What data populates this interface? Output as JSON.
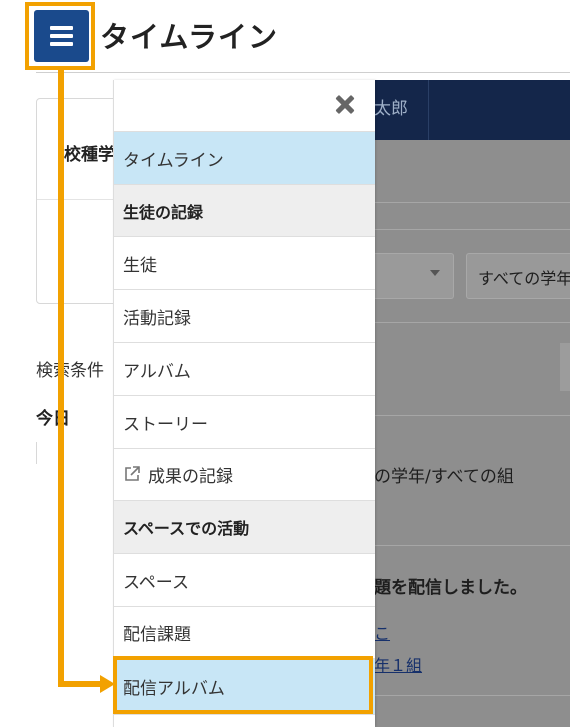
{
  "header": {
    "title": "タイムライン",
    "menu_icon": "hamburger-menu-icon"
  },
  "nav": {
    "user_name": "太郎"
  },
  "background": {
    "school_label": "校種学",
    "search_label": "検索条件",
    "today_label": "今日"
  },
  "overlay": {
    "grade_filter": "すべての学年",
    "summary": "の学年/すべての組",
    "post_text": "題を配信しました。",
    "link_1": "こ",
    "link_2": "年１組"
  },
  "drawer": {
    "close_icon": "close-icon",
    "items": [
      {
        "label": "タイムライン",
        "type": "item",
        "active": true
      },
      {
        "label": "生徒の記録",
        "type": "header"
      },
      {
        "label": "生徒",
        "type": "item"
      },
      {
        "label": "活動記録",
        "type": "item"
      },
      {
        "label": "アルバム",
        "type": "item"
      },
      {
        "label": "ストーリー",
        "type": "item"
      },
      {
        "label": "成果の記録",
        "type": "item",
        "icon": "external-link-icon"
      },
      {
        "label": "スペースでの活動",
        "type": "header"
      },
      {
        "label": "スペース",
        "type": "item"
      },
      {
        "label": "配信課題",
        "type": "item"
      },
      {
        "label": "配信アルバム",
        "type": "item",
        "active": true
      }
    ]
  },
  "colors": {
    "accent_orange": "#f2a100",
    "menu_button_blue": "#1a4a8c",
    "active_item_bg": "#c8e6f6",
    "nav_dark": "#14264a"
  }
}
